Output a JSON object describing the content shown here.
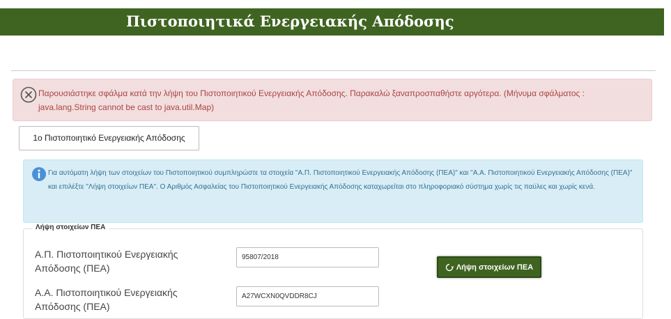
{
  "header": {
    "title": "Πιστοποιητικά Ενεργειακής Απόδοσης"
  },
  "error_alert": {
    "icon": "close-circle-icon",
    "message": "Παρουσιάστηκε σφάλμα κατά την λήψη του Πιστοποιητικού Ενεργειακής Απόδοσης. Παρακαλώ ξαναπροσπαθήστε αργότερα. (Μήνυμα σφάλματος : java.lang.String cannot be cast to java.util.Map)"
  },
  "certificate_tab": {
    "label": "1ο Πιστοποιητικό Ενεργειακής Απόδοσης"
  },
  "info_alert": {
    "icon": "info-icon",
    "message": "Για αυτόματη λήψη των στοιχείων του Πιστοποιητικού συμπληρώστε τα στοιχεία \"Α.Π. Πιστοποιητικού Ενεργειακής Απόδοσης (ΠΕΑ)\" και \"Α.Α. Πιστοποιητικού Ενεργειακής Απόδοσης (ΠΕΑ)\" και επιλέξτε \"Λήψη στοιχείων ΠΕΑ\". Ο Αριθμός Ασφαλείας του Πιστοποιητικού Ενεργειακής Απόδοσης καταχωρείται στο πληροφοριακό σύστημα χωρίς τις παύλες και χωρίς κενά."
  },
  "form": {
    "legend": "Λήψη στοιχείων ΠΕΑ",
    "fields": [
      {
        "label": "Α.Π. Πιστοποιητικού Ενεργειακής Απόδοσης (ΠΕΑ)",
        "value": "95807/2018"
      },
      {
        "label": "Α.Α. Πιστοποιητικού Ενεργειακής Απόδοσης (ΠΕΑ)",
        "value": "A27WCXN0QVDDR8CJ"
      }
    ],
    "fetch_button": {
      "label": "Λήψη στοιχείων ΠΕΑ",
      "icon": "refresh-icon"
    }
  },
  "colors": {
    "header_green": "#3f6421",
    "error_bg": "#f2dede",
    "error_text": "#a94442",
    "info_bg": "#d9edf7",
    "info_text": "#31708f"
  }
}
